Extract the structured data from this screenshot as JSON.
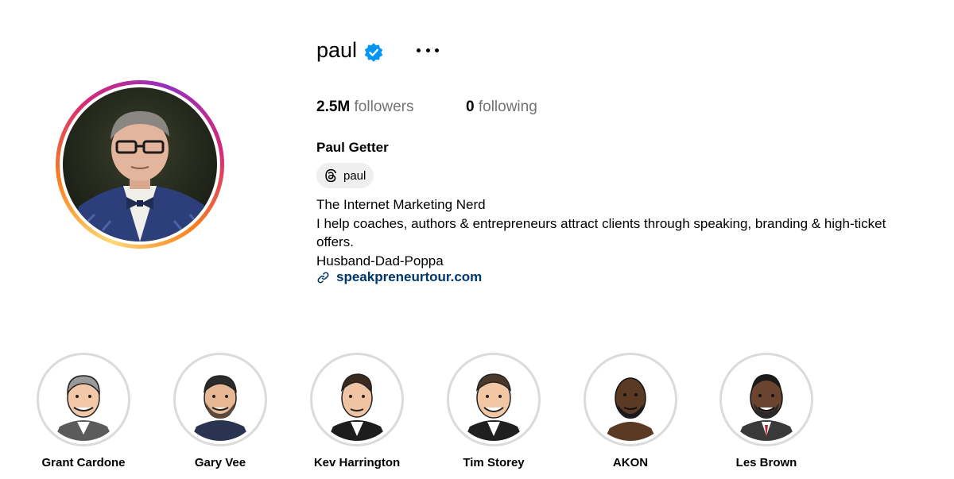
{
  "profile": {
    "username": "paul",
    "verified": true,
    "full_name": "Paul Getter",
    "threads_label": "paul",
    "followers_count": "2.5M",
    "followers_label": "followers",
    "following_count": "0",
    "following_label": "following",
    "bio_lines": [
      "The Internet Marketing Nerd",
      "I help coaches, authors & entrepreneurs attract clients through speaking, branding & high-ticket",
      "offers.",
      "Husband-Dad-Poppa"
    ],
    "link_text": "speakpreneurtour.com"
  },
  "highlights": [
    {
      "label": "Grant Cardone"
    },
    {
      "label": "Gary Vee"
    },
    {
      "label": "Kev Harrington"
    },
    {
      "label": "Tim Storey"
    },
    {
      "label": "AKON"
    },
    {
      "label": "Les Brown"
    }
  ],
  "icons": {
    "verified": "verified-badge-icon",
    "more": "more-options-icon",
    "threads": "threads-icon",
    "link": "link-icon"
  },
  "colors": {
    "verified_blue": "#0095f6",
    "link_blue": "#00376b",
    "muted_text": "#737373",
    "highlight_ring": "#dbdbdb",
    "story_ring_start": "#feda75",
    "story_ring_end": "#d62976"
  }
}
